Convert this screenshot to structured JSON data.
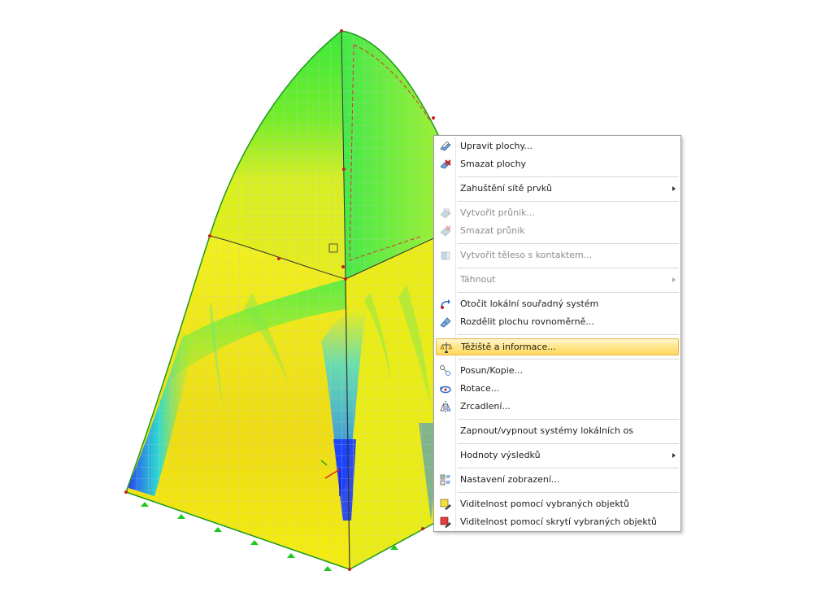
{
  "context_menu": {
    "items": [
      {
        "label": "Upravit plochy...",
        "icon": "edit-surfaces-icon",
        "enabled": true
      },
      {
        "label": "Smazat plochy",
        "icon": "delete-surfaces-icon",
        "enabled": true
      },
      {
        "label": "Zahuštění sítě prvků",
        "icon": "",
        "enabled": true,
        "submenu": true
      },
      {
        "label": "Vytvořit průnik...",
        "icon": "create-intersection-icon",
        "enabled": false
      },
      {
        "label": "Smazat průnik",
        "icon": "delete-intersection-icon",
        "enabled": false
      },
      {
        "label": "Vytvořit těleso s kontaktem...",
        "icon": "create-contact-solid-icon",
        "enabled": false
      },
      {
        "label": "Táhnout",
        "icon": "",
        "enabled": false,
        "submenu": true
      },
      {
        "label": "Otočit lokální souřadný systém",
        "icon": "rotate-local-axes-icon",
        "enabled": true
      },
      {
        "label": "Rozdělit plochu rovnoměrně...",
        "icon": "divide-surface-icon",
        "enabled": true
      },
      {
        "label": "Těžiště a informace...",
        "icon": "centroid-info-icon",
        "enabled": true,
        "highlighted": true
      },
      {
        "label": "Posun/Kopie...",
        "icon": "move-copy-icon",
        "enabled": true
      },
      {
        "label": "Rotace...",
        "icon": "rotate-icon",
        "enabled": true
      },
      {
        "label": "Zrcadlení...",
        "icon": "mirror-icon",
        "enabled": true
      },
      {
        "label": "Zapnout/vypnout systémy lokálních os",
        "icon": "",
        "enabled": true
      },
      {
        "label": "Hodnoty výsledků",
        "icon": "",
        "enabled": true,
        "submenu": true
      },
      {
        "label": "Nastavení zobrazení...",
        "icon": "display-settings-icon",
        "enabled": true
      },
      {
        "label": "Viditelnost pomocí vybraných objektů",
        "icon": "visibility-selected-icon",
        "enabled": true
      },
      {
        "label": "Viditelnost pomocí skrytí vybraných objektů",
        "icon": "visibility-hide-selected-icon",
        "enabled": true
      }
    ]
  },
  "colors": {
    "highlight": "#ffd860",
    "contour_low": "#1a3cff",
    "contour_mid": "#00e0ff",
    "contour_green": "#22ee22",
    "contour_high": "#f4ee00"
  }
}
